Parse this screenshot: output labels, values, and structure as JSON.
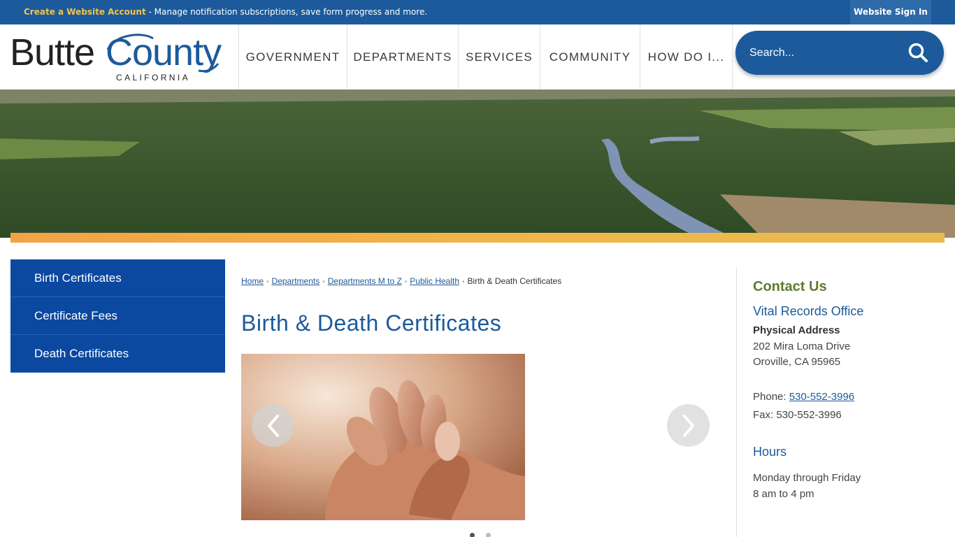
{
  "topbar": {
    "create_account_link": "Create a Website Account",
    "create_account_text": " - Manage notification subscriptions, save form progress and more.",
    "sign_in": "Website Sign In"
  },
  "logo": {
    "name_part1": "Butte",
    "name_part2": "County",
    "state": "CALIFORNIA"
  },
  "nav": {
    "items": [
      "GOVERNMENT",
      "DEPARTMENTS",
      "SERVICES",
      "COMMUNITY",
      "HOW DO I..."
    ]
  },
  "search": {
    "placeholder": "Search...",
    "icon": "search-icon"
  },
  "sidebar": {
    "items": [
      "Birth Certificates",
      "Certificate Fees",
      "Death Certificates"
    ]
  },
  "breadcrumb": {
    "links": [
      "Home",
      "Departments",
      "Departments M to Z",
      "Public Health"
    ],
    "current": "Birth & Death Certificates"
  },
  "main": {
    "title": "Birth & Death Certificates",
    "slideshow": {
      "prev_icon": "chevron-left-icon",
      "next_icon": "chevron-right-icon",
      "slide_count": 2,
      "active_slide": 1
    }
  },
  "contact": {
    "heading": "Contact Us",
    "office": "Vital Records Office",
    "address_label": "Physical Address",
    "address_line1": "202 Mira Loma Drive",
    "address_line2": "Oroville, CA 95965",
    "phone_label": "Phone: ",
    "phone": "530-552-3996",
    "fax": "Fax: 530-552-3996",
    "hours_heading": "Hours",
    "hours_line1": "Monday through Friday",
    "hours_line2": "8 am to 4 pm"
  },
  "colors": {
    "brand_blue": "#1c5a9b",
    "sidebar_blue": "#0b48a0",
    "accent_orange": "#f4a245",
    "link_yellow": "#f1c34a",
    "contact_green": "#5f7a2e"
  }
}
